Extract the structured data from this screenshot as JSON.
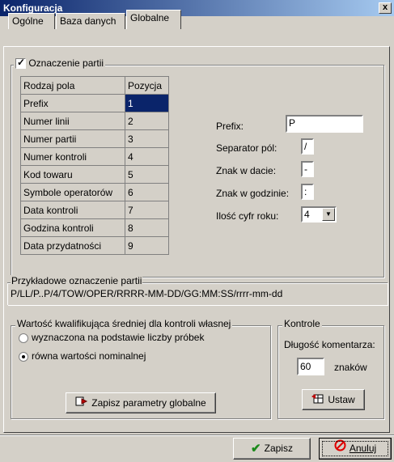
{
  "window": {
    "title": "Konfiguracja",
    "close_label": "x"
  },
  "tabs": [
    {
      "label": "Ogólne"
    },
    {
      "label": "Baza danych"
    },
    {
      "label": "Globalne"
    }
  ],
  "batch_group": {
    "checkbox_label": "Oznaczenie partii",
    "checked": true,
    "table": {
      "headers": [
        "Rodzaj pola",
        "Pozycja"
      ],
      "rows": [
        [
          "Prefix",
          "1"
        ],
        [
          "Numer linii",
          "2"
        ],
        [
          "Numer partii",
          "3"
        ],
        [
          "Numer kontroli",
          "4"
        ],
        [
          "Kod towaru",
          "5"
        ],
        [
          "Symbole operatorów",
          "6"
        ],
        [
          "Data kontroli",
          "7"
        ],
        [
          "Godzina kontroli",
          "8"
        ],
        [
          "Data przydatności",
          "9"
        ]
      ]
    },
    "fields": {
      "prefix_label": "Prefix:",
      "prefix_value": "P",
      "separator_label": "Separator pól:",
      "separator_value": "/",
      "date_char_label": "Znak w dacie:",
      "date_char_value": "-",
      "time_char_label": "Znak w godzinie:",
      "time_char_value": ":",
      "year_digits_label": "Ilość cyfr roku:",
      "year_digits_value": "4"
    }
  },
  "example": {
    "legend": "Przykładowe oznaczenie partii",
    "text": "P/LL/P..P/4/TOW/OPER/RRRR-MM-DD/GG:MM:SS/rrrr-mm-dd"
  },
  "qualifier": {
    "legend": "Wartość kwalifikująca średniej dla kontroli własnej",
    "options": [
      {
        "label": "wyznaczona na podstawie liczby próbek",
        "selected": false
      },
      {
        "label": "równa wartości nominalnej",
        "selected": true
      }
    ],
    "save_button": "Zapisz parametry globalne"
  },
  "controls": {
    "legend": "Kontrole",
    "comment_length_label": "Długość komentarza:",
    "comment_length_value": "60",
    "unit": "znaków",
    "set_button": "Ustaw"
  },
  "footer": {
    "save": "Zapisz",
    "cancel": "Anuluj"
  }
}
